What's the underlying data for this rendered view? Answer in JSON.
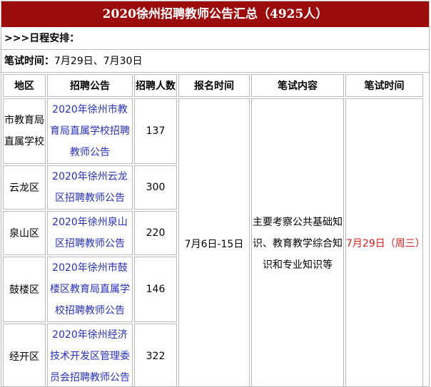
{
  "title": "2020徐州招聘教师公告汇总（4925人）",
  "schedule_label": ">>>日程安排：",
  "exam_time_label": "笔试时间：",
  "exam_time_value": "7月29日、7月30日",
  "table": {
    "headers": [
      "地区",
      "招聘公告",
      "招聘人数",
      "报名时间",
      "笔试内容",
      "笔试时间"
    ],
    "rows": [
      {
        "region": "市教育局直属学校",
        "notice": "2020年徐州市教育局直属学校招聘教师公告",
        "count": "137"
      },
      {
        "region": "云龙区",
        "notice": "2020年徐州云龙区招聘教师公告",
        "count": "300"
      },
      {
        "region": "泉山区",
        "notice": "2020年徐州泉山区招聘教师公告",
        "count": "220"
      },
      {
        "region": "鼓楼区",
        "notice": "2020年徐州市鼓楼区教育局直属学校招聘教师公告",
        "count": "146"
      },
      {
        "region": "经开区",
        "notice": "2020年徐州经济技术开发区管理委员会招聘教师公告",
        "count": "322"
      }
    ],
    "registration_time": "7月6日-15日",
    "exam_content": "主要考察公共基础知识、教育教学综合知识和专业知识等",
    "exam_date": "7月29日（周三）"
  },
  "colors": {
    "title_bg": "#9b0d0d",
    "link": "#2630b5",
    "highlight": "#d21d1d"
  }
}
